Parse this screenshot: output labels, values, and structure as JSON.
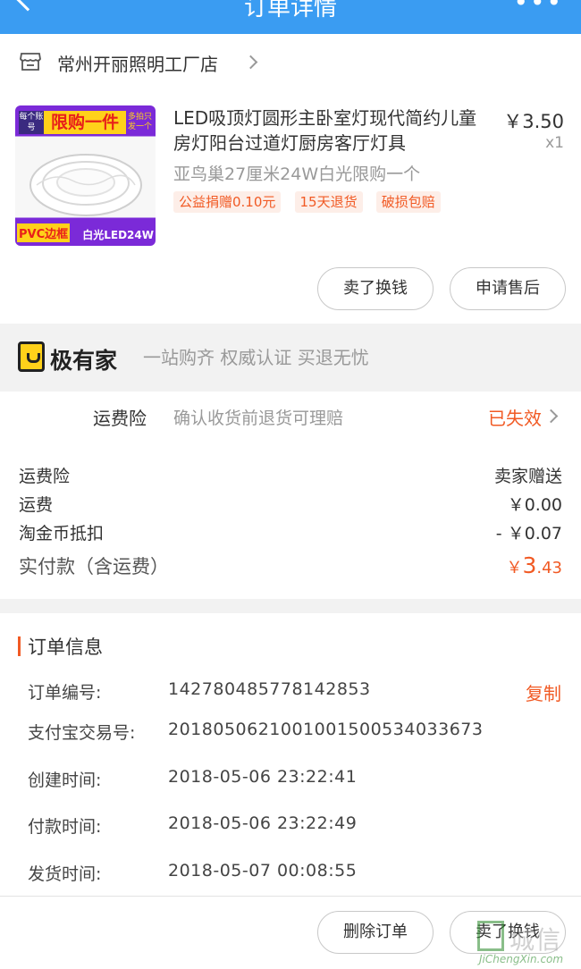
{
  "nav": {
    "title": "订单详情",
    "more": "•••"
  },
  "shop": {
    "name": "常州开丽照明工厂店"
  },
  "product": {
    "image_ribbon_left": "每个账号",
    "image_ribbon_center": "限购一件",
    "image_ribbon_right": "多拍只发一个",
    "image_bottom_left": "PVC边框",
    "image_bottom_right": "白光LED24W",
    "title": "LED吸顶灯圆形主卧室灯现代简约儿童房灯阳台过道灯厨房客厅灯具",
    "price": "￥3.50",
    "quantity": "x1",
    "sku": "亚鸟巢27厘米24W白光限购一个",
    "tags": [
      "公益捐赠0.10元",
      "15天退货",
      "破损包赔"
    ]
  },
  "item_actions": {
    "sell": "卖了换钱",
    "aftersale": "申请售后"
  },
  "banner": {
    "brand": "极有家",
    "slogan": "一站购齐 权威认证 买退无忧"
  },
  "insurance": {
    "label": "运费险",
    "desc": "确认收货前退货可理赔",
    "status": "已失效"
  },
  "costs": [
    {
      "label": "运费险",
      "value": "卖家赠送"
    },
    {
      "label": "运费",
      "value": "￥0.00"
    },
    {
      "label": "淘金币抵扣",
      "value": "- ￥0.07"
    }
  ],
  "total": {
    "label": "实付款（含运费）",
    "currency": "￥",
    "int": "3",
    "dec": ".43"
  },
  "order_info": {
    "title": "订单信息",
    "copy": "复制",
    "rows": [
      {
        "label": "订单编号:",
        "value": "142780485778142853"
      },
      {
        "label": "支付宝交易号:",
        "value": "2018050621001001500534033673"
      },
      {
        "label": "创建时间:",
        "value": "2018-05-06 23:22:41"
      },
      {
        "label": "付款时间:",
        "value": "2018-05-06 23:22:49"
      },
      {
        "label": "发货时间:",
        "value": "2018-05-07 00:08:55"
      }
    ]
  },
  "bottom_actions": {
    "delete": "删除订单",
    "sell": "卖了换钱"
  },
  "watermark": {
    "text": "城信",
    "site": "JiChengXin.com"
  },
  "colors": {
    "accent": "#f15a24",
    "nav": "#3a9cf2"
  }
}
